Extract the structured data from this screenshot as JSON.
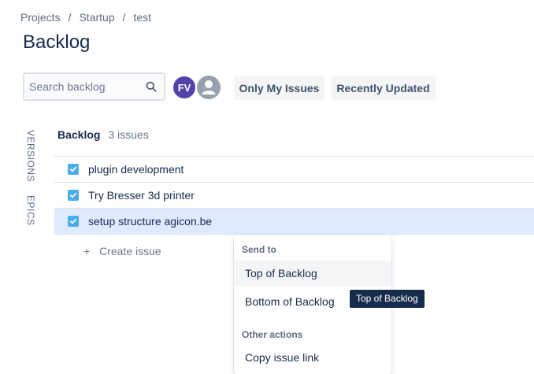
{
  "breadcrumb": {
    "items": [
      "Projects",
      "Startup",
      "test"
    ],
    "separator": "/"
  },
  "page": {
    "title": "Backlog"
  },
  "search": {
    "placeholder": "Search backlog",
    "value": ""
  },
  "avatars": [
    {
      "initials": "FV",
      "color": "#5243aa"
    },
    {
      "icon": "user-icon",
      "color": "#97a0af"
    }
  ],
  "filters": {
    "only_my_issues": "Only My Issues",
    "recently_updated": "Recently Updated"
  },
  "side_tabs": {
    "versions": "VERSIONS",
    "epics": "EPICS"
  },
  "backlog": {
    "name": "Backlog",
    "count": "3 issues",
    "issues": [
      {
        "title": "plugin development",
        "type_icon": "task-icon",
        "selected": false
      },
      {
        "title": "Try Bresser 3d printer",
        "type_icon": "task-icon",
        "selected": false
      },
      {
        "title": "setup structure agicon.be",
        "type_icon": "task-icon",
        "selected": true
      }
    ],
    "create_label": "Create issue",
    "create_icon": "+"
  },
  "context_menu": {
    "send_to_heading": "Send to",
    "top_of_backlog": "Top of Backlog",
    "bottom_of_backlog": "Bottom of Backlog",
    "other_actions_heading": "Other actions",
    "copy_issue_link": "Copy issue link"
  },
  "tooltip": {
    "text": "Top of Backlog"
  },
  "colors": {
    "accent": "#5243aa",
    "task": "#4bade8",
    "selected_row": "#deebff",
    "tooltip_bg": "#172b4d"
  }
}
